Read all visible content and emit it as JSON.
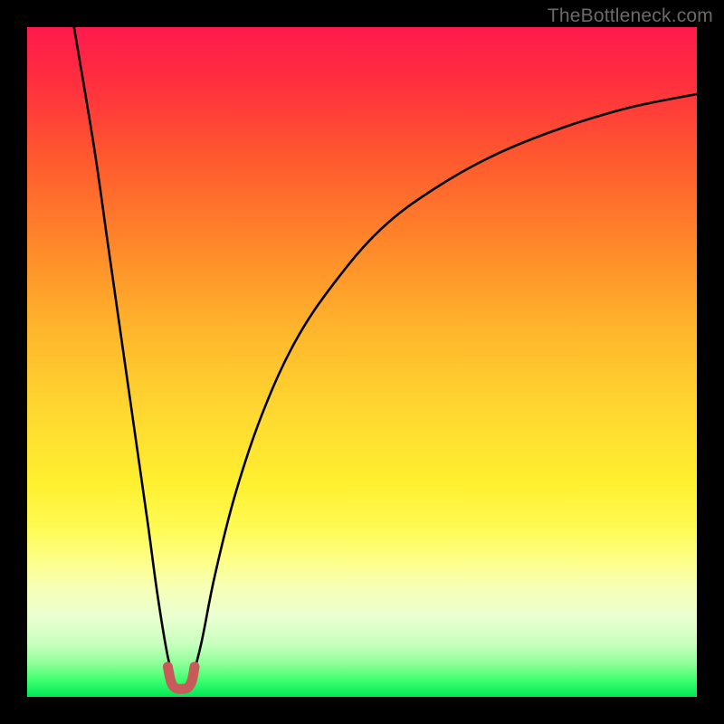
{
  "watermark": "TheBottleneck.com",
  "chart_data": {
    "type": "line",
    "title": "",
    "xlabel": "",
    "ylabel": "",
    "xlim": [
      0,
      100
    ],
    "ylim": [
      0,
      100
    ],
    "series": [
      {
        "name": "left-branch",
        "x": [
          7,
          10,
          12,
          14,
          16,
          18,
          19.5,
          21,
          22.2
        ],
        "y": [
          100,
          82,
          68,
          54,
          40,
          26,
          15,
          6,
          1.5
        ]
      },
      {
        "name": "right-branch",
        "x": [
          24.3,
          26,
          28,
          31,
          35,
          40,
          46,
          53,
          61,
          70,
          80,
          90,
          100
        ],
        "y": [
          1.5,
          8,
          18,
          30,
          42,
          53,
          62,
          70,
          76,
          81,
          85,
          88,
          90
        ]
      },
      {
        "name": "valley-marker",
        "x": [
          21.0,
          21.5,
          22.2,
          23.2,
          24.0,
          24.6,
          25.0
        ],
        "y": [
          4.5,
          2.2,
          1.3,
          1.2,
          1.4,
          2.4,
          4.5
        ]
      }
    ],
    "colors": {
      "curve": "#000000",
      "marker": "#c85a5a"
    }
  }
}
